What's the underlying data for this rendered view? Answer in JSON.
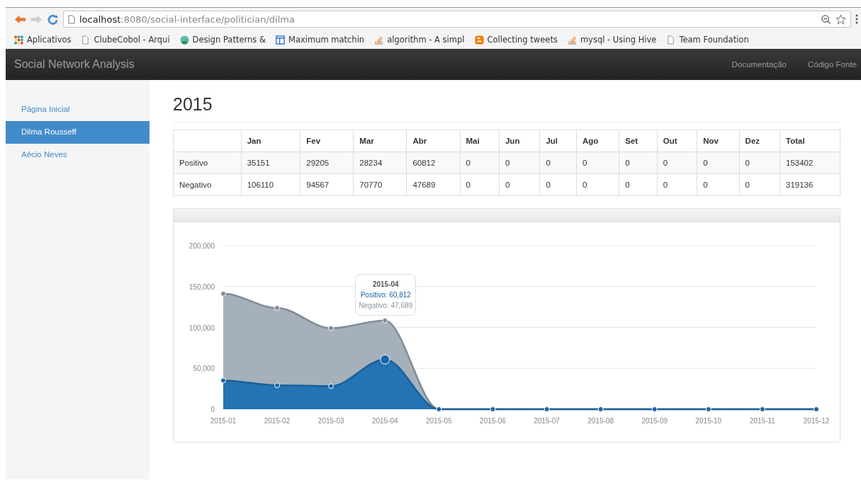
{
  "browser": {
    "url_host": "localhost",
    "url_path": ":8080/social-interface/politician/dilma",
    "bookmarks": [
      {
        "label": "Aplicativos",
        "kind": "apps"
      },
      {
        "label": "ClubeCobol - Arqui",
        "kind": "page"
      },
      {
        "label": "Design Patterns &",
        "kind": "globe"
      },
      {
        "label": "Maximum matchin",
        "kind": "window"
      },
      {
        "label": "algorithm - A simpl",
        "kind": "stack"
      },
      {
        "label": "Collecting tweets",
        "kind": "blog"
      },
      {
        "label": "mysql - Using Hive",
        "kind": "stack"
      },
      {
        "label": "Team Foundation",
        "kind": "page"
      }
    ]
  },
  "navbar": {
    "brand": "Social Network Analysis",
    "links": [
      "Documentação",
      "Código Fonte"
    ]
  },
  "sidebar": {
    "items": [
      {
        "label": "Página Inicial",
        "selected": false
      },
      {
        "label": "Dilma Rousseff",
        "selected": true
      },
      {
        "label": "Aécio Neves",
        "selected": false
      }
    ]
  },
  "heading": "2015",
  "table": {
    "columns": [
      "Jan",
      "Fev",
      "Mar",
      "Abr",
      "Mai",
      "Jun",
      "Jul",
      "Ago",
      "Set",
      "Out",
      "Nov",
      "Dez",
      "Total"
    ],
    "rows": [
      {
        "label": "Positivo",
        "cells": [
          "35151",
          "29205",
          "28234",
          "60812",
          "0",
          "0",
          "0",
          "0",
          "0",
          "0",
          "0",
          "0",
          "153402"
        ]
      },
      {
        "label": "Negativo",
        "cells": [
          "106110",
          "94567",
          "70770",
          "47689",
          "0",
          "0",
          "0",
          "0",
          "0",
          "0",
          "0",
          "0",
          "319136"
        ]
      }
    ]
  },
  "chart": {
    "chart_data": {
      "type": "area",
      "stacked": true,
      "categories": [
        "2015-01",
        "2015-02",
        "2015-03",
        "2015-04",
        "2015-05",
        "2015-06",
        "2015-07",
        "2015-08",
        "2015-09",
        "2015-10",
        "2015-11",
        "2015-12"
      ],
      "series": [
        {
          "color": "#2473b5",
          "values": [
            35151,
            29205,
            28234,
            60812,
            0,
            0,
            0,
            0,
            0,
            0,
            0,
            0
          ]
        },
        {
          "color": "#a5b0ba",
          "values": [
            106110,
            94567,
            70770,
            47689,
            0,
            0,
            0,
            0,
            0,
            0,
            0,
            0
          ]
        }
      ],
      "ylim": [
        0,
        200000
      ],
      "grid": true,
      "yticks": [
        {
          "value": 0,
          "label": "0"
        },
        {
          "value": 50000,
          "label": "50,000"
        },
        {
          "value": 100000,
          "label": "100,000"
        },
        {
          "value": 150000,
          "label": "150,000"
        },
        {
          "value": 200000,
          "label": "200,000"
        }
      ]
    },
    "tooltip": {
      "title": "2015-04",
      "lines": [
        "Positivo: 60,812",
        "Negativo: 47,689"
      ]
    }
  }
}
